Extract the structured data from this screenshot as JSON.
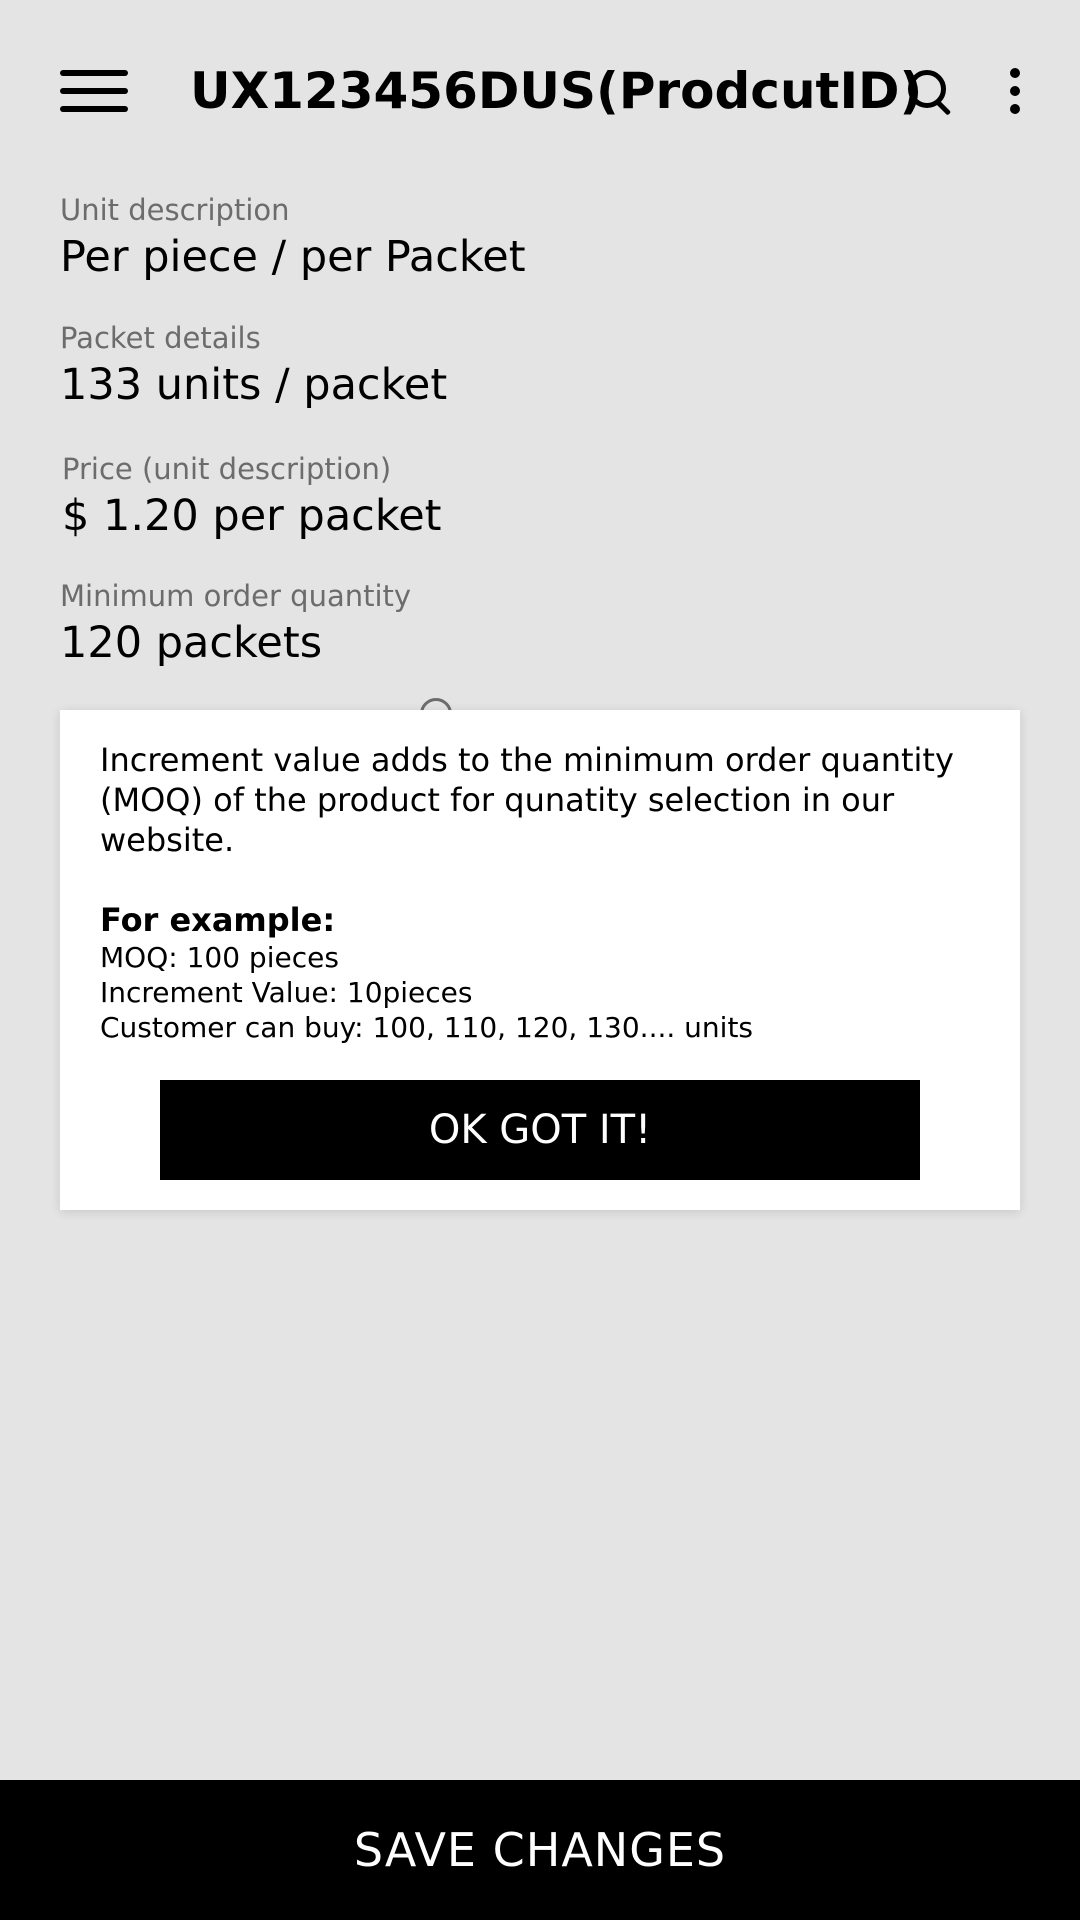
{
  "appbar": {
    "title": "UX123456DUS(ProdcutID)",
    "menu_icon": "hamburger-menu-icon",
    "search_icon": "search-icon",
    "more_icon": "more-vertical-icon"
  },
  "fields": {
    "unit_description": {
      "label": "Unit description",
      "value": "Per piece / per Packet"
    },
    "packet_details": {
      "label": "Packet details",
      "value": "133 units / packet"
    },
    "price": {
      "label": "Price (unit description)",
      "value": "$ 1.20 per packet"
    },
    "minimum_order_quantity": {
      "label": "Minimum order quantity",
      "value": "120 packets"
    }
  },
  "dialog": {
    "description": "Increment value adds to the minimum order quantity (MOQ) of the product for qunatity selection in our website.",
    "example_heading": "For example:",
    "example_lines": [
      "MOQ: 100 pieces",
      "Increment Value: 10pieces",
      "Customer can buy: 100, 110, 120, 130.... units"
    ],
    "ok_label": "OK GOT IT!"
  },
  "footer": {
    "save_label": "SAVE CHANGES"
  },
  "colors": {
    "background": "#e4e4e4",
    "dialog_background": "#ffffff",
    "button_background": "#000000",
    "label_text": "#6c6c6c"
  }
}
